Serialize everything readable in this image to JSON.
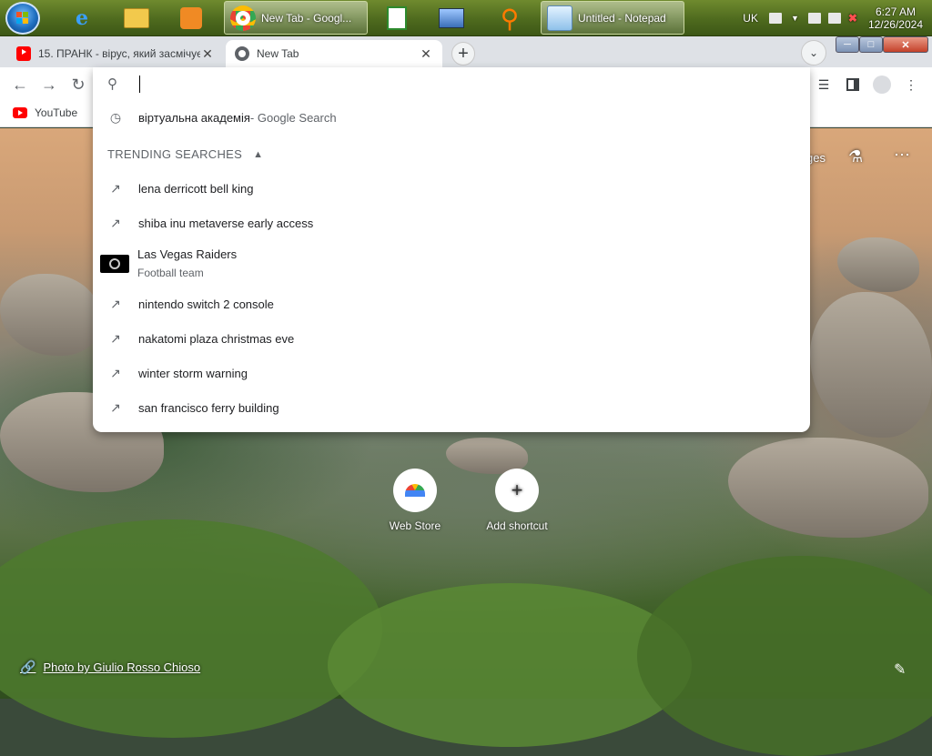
{
  "taskbar": {
    "chrome_button": "New Tab - Googl...",
    "notepad_button": "Untitled - Notepad",
    "lang": "UK",
    "time": "6:27 AM",
    "date": "12/26/2024"
  },
  "tabs": {
    "inactive_title": "15. ПРАНК - вірус, який засмічує",
    "active_title": "New Tab"
  },
  "bookmarks": {
    "youtube": "YouTube"
  },
  "omnibox": {
    "value": "",
    "history_item": {
      "text": "віртуальна академія",
      "suffix": " - Google Search"
    },
    "trending_label": "TRENDING SEARCHES",
    "trending": [
      "lena derricott bell king",
      "shiba inu metaverse early access",
      "nintendo switch 2 console",
      "nakatomi plaza christmas eve",
      "winter storm warning",
      "san francisco ferry building"
    ],
    "entity": {
      "title": "Las Vegas Raiders",
      "subtitle": "Football team"
    }
  },
  "ntp": {
    "images_link": "ges",
    "shortcuts": [
      {
        "label": "Web Store"
      },
      {
        "label": "Add shortcut"
      }
    ],
    "photo_credit": "Photo by Giulio Rosso Chioso"
  },
  "colors": {
    "taskbar": "#4e6a1e",
    "tabstrip": "#dee1e6",
    "close_red": "#c4412a"
  }
}
